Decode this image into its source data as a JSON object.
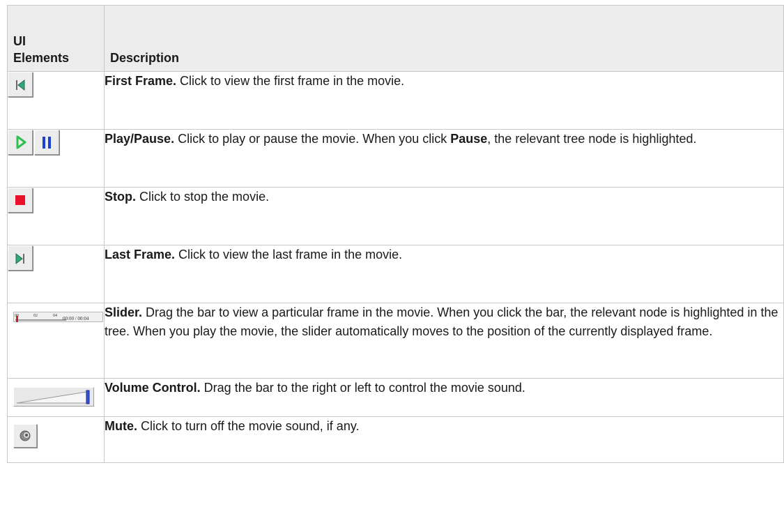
{
  "header": {
    "col1": "UI\nElements",
    "col1_line1": "UI",
    "col1_line2": "Elements",
    "col2": "Description"
  },
  "rows": [
    {
      "icon": "first-frame-icon",
      "title": "First Frame.",
      "text": " Click to view the first frame in the movie."
    },
    {
      "icon": "play-pause-icon",
      "title": "Play/Pause.",
      "text_a": " Click to play or pause the movie. When you click ",
      "bold_mid": "Pause",
      "text_b": ", the relevant tree node is highlighted."
    },
    {
      "icon": "stop-icon",
      "title": "Stop.",
      "text": " Click to stop the movie."
    },
    {
      "icon": "last-frame-icon",
      "title": "Last Frame.",
      "text": " Click to view the last frame in the movie."
    },
    {
      "icon": "slider-icon",
      "title": "Slider.",
      "text": " Drag the bar to view a particular frame in the movie. When you click the bar, the relevant node is highlighted in the tree. When you play the movie, the slider automatically moves to the position of the currently displayed frame.",
      "slider_ticks": [
        "00",
        "02",
        "04"
      ],
      "slider_time": "00:00 / 00:04"
    },
    {
      "icon": "volume-control-icon",
      "title": "Volume Control.",
      "text": " Drag the bar to the right or left to control the movie sound."
    },
    {
      "icon": "mute-icon",
      "title": "Mute.",
      "text": " Click to turn off the movie sound, if any."
    }
  ],
  "colors": {
    "play_green": "#2fbf4a",
    "pause_blue": "#1e3fd0",
    "stop_red": "#e8102a",
    "frame_teal": "#2fa878"
  }
}
